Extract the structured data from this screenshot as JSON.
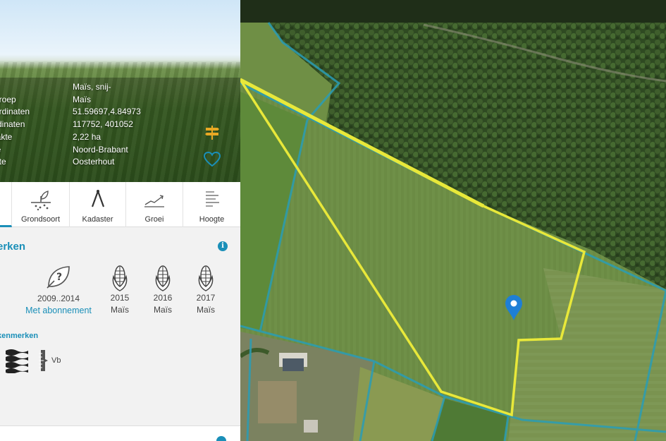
{
  "parcel_info": {
    "rows": [
      {
        "key": "",
        "value": "Maïs, snij-"
      },
      {
        "key": "groep",
        "value": "Maïs"
      },
      {
        "key": "ördinaten",
        "value": "51.59697,4.84973"
      },
      {
        "key": "rdinaten",
        "value": "117752, 401052"
      },
      {
        "key": "lakte",
        "value": "2,22 ha"
      },
      {
        "key": "ie",
        "value": "Noord-Brabant"
      },
      {
        "key": "nte",
        "value": "Oosterhout"
      }
    ]
  },
  "tabs": [
    {
      "label": "",
      "icon": "tab-partial-icon"
    },
    {
      "label": "Grondsoort",
      "icon": "soil-sprout-icon"
    },
    {
      "label": "Kadaster",
      "icon": "cadastre-compass-icon"
    },
    {
      "label": "Groei",
      "icon": "growth-chart-icon"
    },
    {
      "label": "Hoogte",
      "icon": "height-lines-icon"
    }
  ],
  "crop_history": {
    "title": "erken",
    "unknown": {
      "years": "2009..2014",
      "link": "Met abonnement",
      "icon": "question-leaf-icon"
    },
    "years": [
      {
        "year": "2015",
        "crop": "Maïs",
        "icon": "corn-icon"
      },
      {
        "year": "2016",
        "crop": "Maïs",
        "icon": "corn-icon"
      },
      {
        "year": "2017",
        "crop": "Maïs",
        "icon": "corn-icon"
      }
    ]
  },
  "features": {
    "title": "kenmerken",
    "items": [
      {
        "icon": "water-waves-icon",
        "label": ""
      },
      {
        "icon": "vb-ruler-icon",
        "label": "Vb"
      }
    ]
  },
  "colors": {
    "accent": "#1a8fb8",
    "parcel_outline": "#e8e83a",
    "cadastre_lines": "#2a9db5",
    "hero_icon": "#e8a824"
  }
}
